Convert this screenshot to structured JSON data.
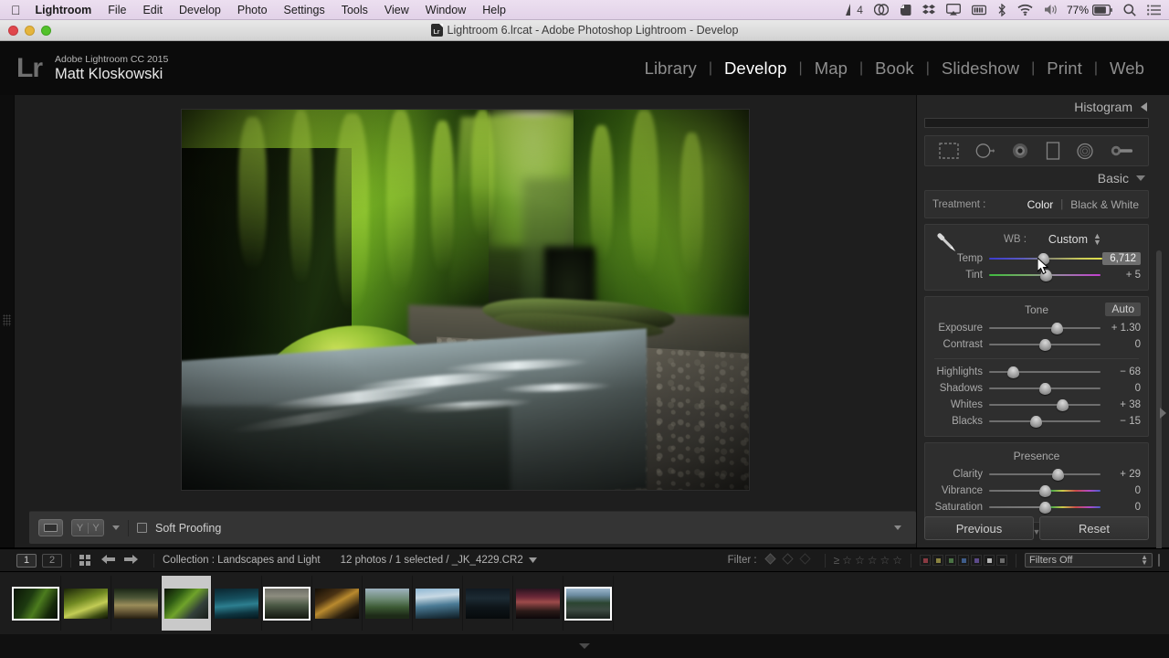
{
  "macmenu": {
    "apple": "apple-logo",
    "items": [
      "Lightroom",
      "File",
      "Edit",
      "Develop",
      "Photo",
      "Settings",
      "Tools",
      "View",
      "Window",
      "Help"
    ],
    "status": {
      "notification_count": "4",
      "battery_percent": "77%",
      "icons": [
        "creative-cloud-icon",
        "evernote-icon",
        "dropbox-icon",
        "airplay-icon",
        "battery-meter-icon",
        "bluetooth-icon",
        "wifi-icon",
        "volume-icon",
        "spotlight-search-icon",
        "notification-center-icon"
      ]
    }
  },
  "window": {
    "title": "Lightroom 6.lrcat - Adobe Photoshop Lightroom - Develop",
    "buttons": [
      "close",
      "minimize",
      "zoom"
    ]
  },
  "identity": {
    "logo": "Lr",
    "line1": "Adobe Lightroom CC 2015",
    "line2": "Matt Kloskowski"
  },
  "modules": {
    "items": [
      "Library",
      "Develop",
      "Map",
      "Book",
      "Slideshow",
      "Print",
      "Web"
    ],
    "active": "Develop"
  },
  "rightpanel": {
    "histogram_title": "Histogram",
    "basic_title": "Basic",
    "tools": [
      "crop-overlay-icon",
      "spot-removal-icon",
      "red-eye-correction-icon",
      "graduated-filter-icon",
      "radial-filter-icon",
      "adjustment-brush-icon"
    ],
    "treatment": {
      "label": "Treatment :",
      "options": [
        "Color",
        "Black & White"
      ],
      "selected": "Color"
    },
    "whitebalance": {
      "label": "WB :",
      "value": "Custom",
      "eyedropper": "white-balance-selector-icon"
    },
    "wb_sliders": [
      {
        "name": "Temp",
        "value": "6,712",
        "pos": 48,
        "track": "temp",
        "highlighted": true
      },
      {
        "name": "Tint",
        "value": "+ 5",
        "pos": 51,
        "track": "tint",
        "highlighted": false
      }
    ],
    "tone": {
      "title": "Tone",
      "auto_label": "Auto",
      "sliders_top": [
        {
          "name": "Exposure",
          "value": "+ 1.30",
          "pos": 61,
          "track": "plain"
        },
        {
          "name": "Contrast",
          "value": "0",
          "pos": 50,
          "track": "plain"
        }
      ],
      "sliders_bottom": [
        {
          "name": "Highlights",
          "value": "− 68",
          "pos": 22,
          "track": "plain"
        },
        {
          "name": "Shadows",
          "value": "0",
          "pos": 50,
          "track": "plain"
        },
        {
          "name": "Whites",
          "value": "+ 38",
          "pos": 66,
          "track": "plain"
        },
        {
          "name": "Blacks",
          "value": "− 15",
          "pos": 42,
          "track": "plain"
        }
      ]
    },
    "presence": {
      "title": "Presence",
      "sliders": [
        {
          "name": "Clarity",
          "value": "+ 29",
          "pos": 62,
          "track": "plain"
        },
        {
          "name": "Vibrance",
          "value": "0",
          "pos": 50,
          "track": "vib"
        },
        {
          "name": "Saturation",
          "value": "0",
          "pos": 50,
          "track": "sat"
        }
      ]
    },
    "buttons": {
      "previous": "Previous",
      "reset": "Reset"
    }
  },
  "phototoolbar": {
    "view_icon": "loupe-view-icon",
    "compare_icon": "before-after-icon",
    "dropdown_icon": "chevron-down-icon",
    "softproofing_label": "Soft Proofing",
    "softproofing_checked": false,
    "panel_toggle": "chevron-down-icon"
  },
  "filmstripbar": {
    "page_main": "1",
    "page_second": "2",
    "grid_icon": "grid-view-icon",
    "back_icon": "go-back-icon",
    "forward_icon": "go-forward-icon",
    "collection": "Collection : Landscapes and Light",
    "photo_count": "12 photos / 1 selected / _JK_4229.CR2",
    "count_caret": "chevron-down-icon",
    "filter_label": "Filter :",
    "flag_icons": [
      "flag-picked-icon",
      "flag-rejected-icon"
    ],
    "rating_operator": "≥",
    "stars": [
      "star-1",
      "star-2",
      "star-3",
      "star-4",
      "star-5"
    ],
    "color_swatches": [
      "#6b3036",
      "#6b6330",
      "#3a5a36",
      "#2f4a6b",
      "#4a3a6b",
      "#8a8a8a",
      "#5a5a5a"
    ],
    "filter_preset": "Filters Off",
    "filter_stepper": "stepper-icon",
    "lock_icon": "filter-lock-icon"
  },
  "filmstrip": {
    "selected_index": 3,
    "thumbs": [
      {
        "name": "thumb-1",
        "bordered": true,
        "g": "linear-gradient(120deg,#0a1406 0%,#1d3a10 35%,#4c7c1e 55%,#16290a 80%,#070d04 100%)"
      },
      {
        "name": "thumb-2",
        "bordered": false,
        "g": "linear-gradient(160deg,#1a2408 0%,#718a22 40%,#c2cc55 62%,#3b4a12 85%,#0d1205 100%)"
      },
      {
        "name": "thumb-3",
        "bordered": false,
        "g": "linear-gradient(180deg,#1b2616 0%,#4c5637 30%,#9a8d5a 55%,#6b5c3a 75%,#241d10 100%)"
      },
      {
        "name": "thumb-4",
        "bordered": false,
        "g": "linear-gradient(135deg,#0b1206 0%,#2f5c14 28%,#6fa32a 48%,#33403a 72%,#171d18 100%)"
      },
      {
        "name": "thumb-5",
        "bordered": false,
        "g": "linear-gradient(175deg,#0a2630 0%,#16505f 35%,#2d7f90 55%,#0e3540 80%,#05171d 100%)"
      },
      {
        "name": "thumb-6",
        "bordered": true,
        "g": "linear-gradient(180deg,#6e6e66 0%,#8d8d80 25%,#4c5a45 55%,#2a3226 80%,#15180f 100%)"
      },
      {
        "name": "thumb-7",
        "bordered": false,
        "g": "linear-gradient(150deg,#120d06 0%,#4a3213 30%,#b98a2e 48%,#2d2110 75%,#0a0805 100%)"
      },
      {
        "name": "thumb-8",
        "bordered": false,
        "g": "linear-gradient(180deg,#9fb3c0 0%,#6d8a74 35%,#3c5a34 62%,#1d2a17 90%)"
      },
      {
        "name": "thumb-9",
        "bordered": false,
        "g": "linear-gradient(175deg,#8fb8d4 0%,#c8d9e4 28%,#4b7b96 55%,#24404f 82%,#101c23 100%)"
      },
      {
        "name": "thumb-10",
        "bordered": false,
        "g": "linear-gradient(180deg,#101a22 0%,#1c2a33 32%,#0e1519 62%,#060a0c 100%)"
      },
      {
        "name": "thumb-11",
        "bordered": false,
        "g": "linear-gradient(180deg,#2a1420 0%,#6b2838 28%,#9c4a4a 45%,#2a1a18 75%,#0c0709 100%)"
      },
      {
        "name": "thumb-12",
        "bordered": true,
        "g": "linear-gradient(180deg,#9db7cc 0%,#6b8ba0 22%,#2b4431 48%,#3c4a42 70%,#19211c 100%)"
      }
    ]
  },
  "colors": {
    "panel_bg": "#252525",
    "section_bg": "#2e2e2e",
    "accent_text": "#ffffff",
    "menu_bg": "#e6d7ec"
  }
}
